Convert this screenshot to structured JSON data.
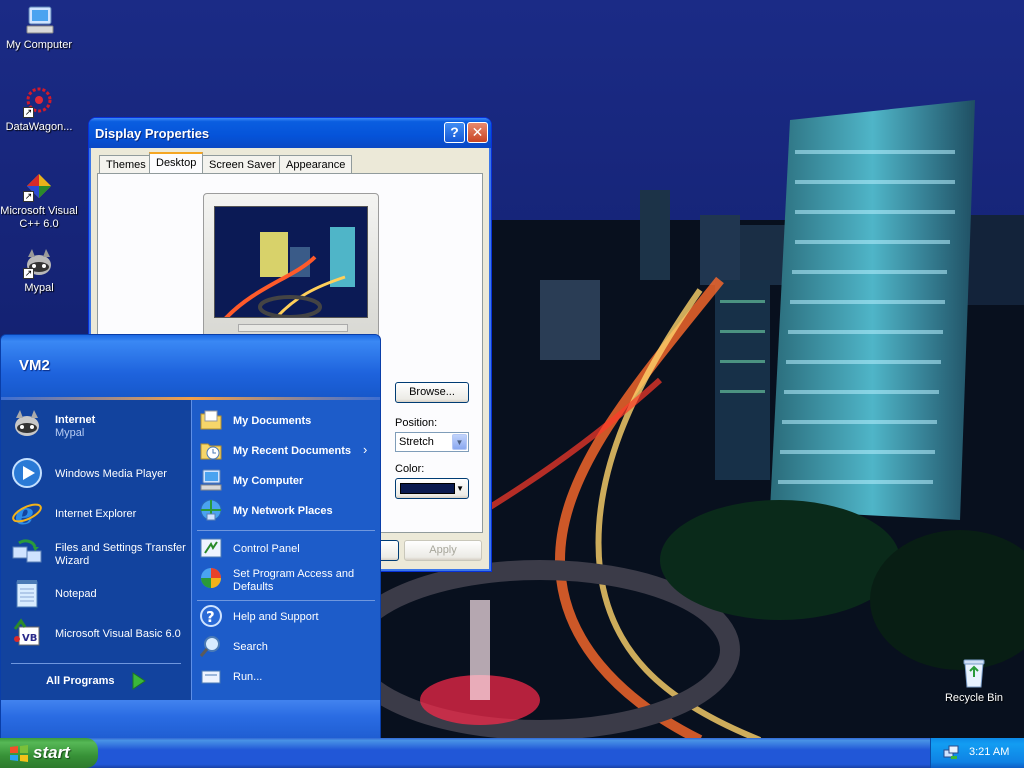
{
  "desktop": {
    "icons": [
      {
        "label": "My Computer",
        "icon": "my-computer-icon"
      },
      {
        "label": "DataWagon...",
        "icon": "datawagon-icon"
      },
      {
        "label": "Microsoft Visual C++ 6.0",
        "icon": "visual-cpp-icon"
      },
      {
        "label": "Mypal",
        "icon": "mypal-icon"
      },
      {
        "label": "Recycle Bin",
        "icon": "recycle-bin-icon"
      }
    ]
  },
  "display_properties": {
    "title": "Display Properties",
    "help_label": "?",
    "close_label": "✕",
    "tabs": [
      {
        "label": "Themes"
      },
      {
        "label": "Desktop",
        "active": true
      },
      {
        "label": "Screen Saver"
      },
      {
        "label": "Appearance"
      }
    ],
    "browse_label": "Browse...",
    "position_label": "Position:",
    "position_value": "Stretch",
    "color_label": "Color:",
    "color_value": "#0a1a4f",
    "apply_label": "Apply"
  },
  "start_menu": {
    "user": "VM2",
    "left_items": [
      {
        "label": "Internet",
        "sublabel": "Mypal",
        "icon": "mypal-icon",
        "bold": true
      },
      {
        "label": "Windows Media Player",
        "icon": "media-player-icon"
      },
      {
        "label": "Internet Explorer",
        "icon": "internet-explorer-icon"
      },
      {
        "label": "Files and Settings Transfer",
        "sublabel": "Wizard",
        "icon": "transfer-wizard-icon"
      },
      {
        "label": "Notepad",
        "icon": "notepad-icon"
      },
      {
        "label": "Microsoft Visual Basic 6.0",
        "icon": "visual-basic-icon"
      }
    ],
    "all_programs_label": "All Programs",
    "right_items": [
      {
        "label": "My Documents",
        "icon": "my-documents-icon",
        "bold": true
      },
      {
        "label": "My Recent Documents",
        "icon": "recent-documents-icon",
        "bold": true,
        "arrow": "›"
      },
      {
        "label": "My Computer",
        "icon": "my-computer-icon",
        "bold": true
      },
      {
        "label": "My Network Places",
        "icon": "network-places-icon",
        "bold": true
      },
      {
        "label": "Control Panel",
        "icon": "control-panel-icon"
      },
      {
        "label": "Set Program Access and",
        "sublabel": "Defaults",
        "icon": "program-access-icon"
      },
      {
        "label": "Help and Support",
        "icon": "help-icon"
      },
      {
        "label": "Search",
        "icon": "search-icon"
      },
      {
        "label": "Run...",
        "icon": "run-icon"
      }
    ]
  },
  "taskbar": {
    "start_label": "start",
    "clock": "3:21 AM"
  }
}
